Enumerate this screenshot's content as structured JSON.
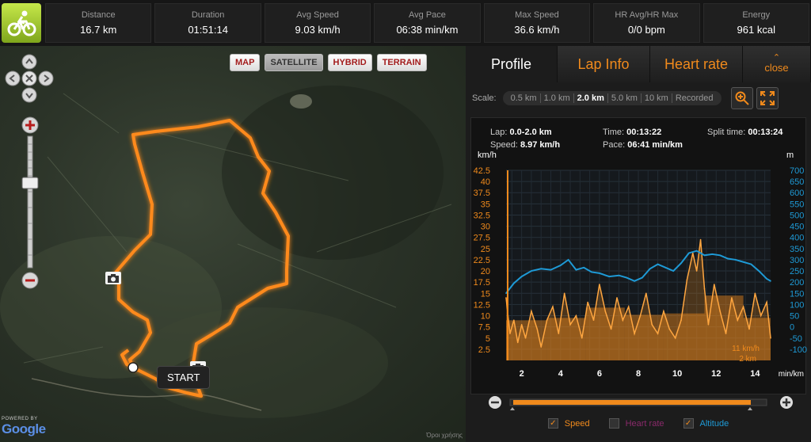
{
  "stats": [
    {
      "label": "Distance",
      "value": "16.7 km"
    },
    {
      "label": "Duration",
      "value": "01:51:14"
    },
    {
      "label": "Avg Speed",
      "value": "9.03 km/h"
    },
    {
      "label": "Avg Pace",
      "value": "06:38 min/km"
    },
    {
      "label": "Max Speed",
      "value": "36.6 km/h"
    },
    {
      "label": "HR Avg/HR Max",
      "value": "0/0 bpm"
    },
    {
      "label": "Energy",
      "value": "961 kcal"
    }
  ],
  "map": {
    "types": [
      "MAP",
      "SATELLITE",
      "HYBRID",
      "TERRAIN"
    ],
    "selected_type": "SATELLITE",
    "start_label": "START",
    "powered_by": "POWERED BY",
    "google": "Google",
    "attribution": "Όροι χρήσης"
  },
  "panel": {
    "tabs": [
      "Profile",
      "Lap Info",
      "Heart rate"
    ],
    "active_tab": "Profile",
    "close_label": "close",
    "scale_label": "Scale:",
    "scales": [
      "0.5 km",
      "1.0 km",
      "2.0 km",
      "5.0 km",
      "10 km",
      "Recorded"
    ],
    "selected_scale": "2.0 km",
    "info": {
      "lap_label": "Lap:",
      "lap_value": "0.0-2.0 km",
      "speed_label": "Speed:",
      "speed_value": "8.97 km/h",
      "time_label": "Time:",
      "time_value": "00:13:22",
      "pace_label": "Pace:",
      "pace_value": "06:41 min/km",
      "split_label": "Split time:",
      "split_value": "00:13:24"
    },
    "legend": {
      "speed": "Speed",
      "heart_rate": "Heart rate",
      "altitude": "Altitude"
    }
  },
  "colors": {
    "accent": "#f08a1c",
    "altitude": "#1e9ad6",
    "heart_rate": "#8a2a6b"
  },
  "chart_data": {
    "type": "line",
    "title": "",
    "xlabel": "min/km",
    "ylabel_left": "km/h",
    "ylabel_right": "m",
    "x_ticks": [
      2,
      4,
      6,
      8,
      10,
      12,
      14
    ],
    "xlim": [
      1.2,
      14.8
    ],
    "y_left_ticks": [
      2.5,
      5,
      7.5,
      10,
      12.5,
      15,
      17.5,
      20,
      22.5,
      25,
      27.5,
      30,
      32.5,
      35,
      37.5,
      40,
      42.5
    ],
    "ylim_left": [
      0,
      42.5
    ],
    "y_right_ticks": [
      -100,
      -50,
      0,
      50,
      100,
      150,
      200,
      250,
      300,
      350,
      400,
      450,
      500,
      550,
      600,
      650,
      700
    ],
    "ylim_right": [
      -150,
      700
    ],
    "marker_label_speed": "11 km/h",
    "marker_label_distance": "2 km",
    "series": [
      {
        "name": "Altitude",
        "axis": "right",
        "x": [
          1.2,
          1.6,
          2.0,
          2.5,
          3.0,
          3.5,
          4.0,
          4.4,
          4.8,
          5.2,
          5.6,
          6.0,
          6.5,
          7.0,
          7.4,
          7.8,
          8.2,
          8.6,
          9.0,
          9.4,
          9.8,
          10.2,
          10.6,
          11.0,
          11.4,
          11.8,
          12.2,
          12.6,
          13.0,
          13.4,
          13.8,
          14.2,
          14.6,
          14.8
        ],
        "values": [
          150,
          195,
          225,
          250,
          260,
          255,
          275,
          300,
          255,
          265,
          245,
          240,
          225,
          230,
          220,
          205,
          220,
          260,
          280,
          265,
          250,
          285,
          330,
          340,
          320,
          325,
          320,
          305,
          300,
          290,
          280,
          250,
          215,
          205
        ]
      },
      {
        "name": "Speed",
        "axis": "left",
        "x": [
          1.2,
          1.4,
          1.6,
          1.8,
          2.0,
          2.2,
          2.5,
          2.8,
          3.0,
          3.3,
          3.6,
          3.9,
          4.2,
          4.5,
          4.8,
          5.1,
          5.4,
          5.7,
          6.0,
          6.3,
          6.6,
          6.9,
          7.2,
          7.5,
          7.8,
          8.1,
          8.4,
          8.7,
          9.0,
          9.3,
          9.6,
          9.9,
          10.2,
          10.5,
          10.8,
          11.0,
          11.2,
          11.4,
          11.6,
          11.9,
          12.2,
          12.5,
          12.8,
          13.1,
          13.4,
          13.7,
          14.0,
          14.3,
          14.6,
          14.8
        ],
        "values": [
          14,
          6,
          9,
          4,
          8,
          5,
          11,
          7,
          3,
          9,
          12,
          6,
          15,
          8,
          10,
          5,
          13,
          9,
          17,
          11,
          7,
          14,
          9,
          12,
          6,
          10,
          15,
          8,
          6,
          11,
          7,
          5,
          9,
          18,
          24,
          20,
          27,
          16,
          8,
          17,
          11,
          6,
          14,
          9,
          12,
          7,
          15,
          10,
          13,
          5
        ]
      },
      {
        "name": "Speed (lap avg)",
        "axis": "left",
        "bins": [
          [
            1.2,
            3.3,
            8.97
          ],
          [
            3.3,
            5.3,
            9.5
          ],
          [
            5.3,
            7.3,
            11.8
          ],
          [
            7.3,
            9.3,
            10.2
          ],
          [
            9.3,
            11.4,
            10.5
          ],
          [
            11.4,
            13.4,
            14.5
          ],
          [
            13.4,
            14.8,
            9.5
          ]
        ]
      }
    ]
  }
}
